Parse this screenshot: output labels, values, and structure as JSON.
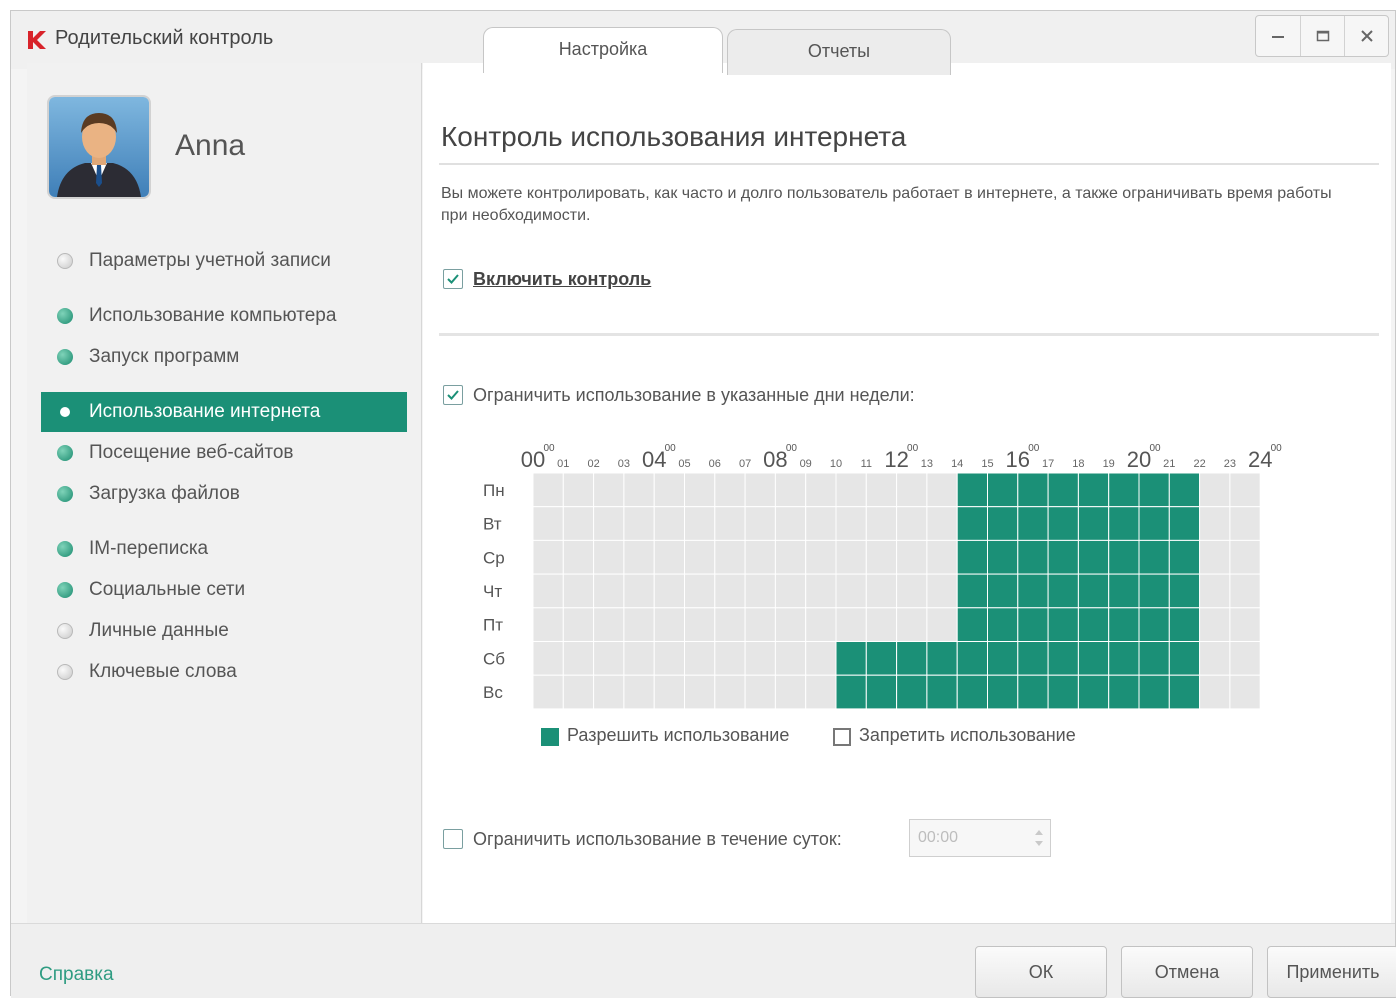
{
  "app": {
    "title": "Родительский контроль",
    "logo_icon": "kaspersky-k-icon",
    "accent_color": "#1b9077",
    "logo_color": "#d8232a"
  },
  "tabs": [
    {
      "label": "Настройка",
      "active": true
    },
    {
      "label": "Отчеты",
      "active": false
    }
  ],
  "window_controls": [
    "minimize-icon",
    "maximize-icon",
    "close-icon"
  ],
  "user": {
    "name": "Anna"
  },
  "sidebar": {
    "items": [
      {
        "label": "Параметры учетной записи",
        "status": "off"
      },
      {
        "label": "Использование компьютера",
        "status": "on"
      },
      {
        "label": "Запуск программ",
        "status": "on"
      },
      {
        "label": "Использование интернета",
        "status": "on",
        "selected": true
      },
      {
        "label": "Посещение веб-сайтов",
        "status": "on"
      },
      {
        "label": "Загрузка файлов",
        "status": "on"
      },
      {
        "label": "IM-переписка",
        "status": "on"
      },
      {
        "label": "Социальные сети",
        "status": "on"
      },
      {
        "label": "Личные данные",
        "status": "off"
      },
      {
        "label": "Ключевые слова",
        "status": "off"
      }
    ]
  },
  "main": {
    "title": "Контроль использования интернета",
    "description": "Вы можете контролировать, как часто и долго пользователь работает в интернете, а также ограничивать время работы при необходимости.",
    "enable_control": {
      "label": "Включить контроль",
      "checked": true
    },
    "limit_days": {
      "label": "Ограничить использование в указанные дни недели:",
      "checked": true
    },
    "schedule": {
      "days": [
        "Пн",
        "Вт",
        "Ср",
        "Чт",
        "Пт",
        "Сб",
        "Вс"
      ],
      "major_hours": [
        "00",
        "04",
        "08",
        "12",
        "16",
        "20",
        "24"
      ],
      "major_superscript": "00",
      "minor_hours": [
        "01",
        "02",
        "03",
        "05",
        "06",
        "07",
        "09",
        "10",
        "11",
        "13",
        "14",
        "15",
        "17",
        "18",
        "19",
        "21",
        "22",
        "23"
      ],
      "allowed": [
        {
          "day": "Пн",
          "from": 14,
          "to": 22
        },
        {
          "day": "Вт",
          "from": 14,
          "to": 22
        },
        {
          "day": "Ср",
          "from": 14,
          "to": 22
        },
        {
          "day": "Чт",
          "from": 14,
          "to": 22
        },
        {
          "day": "Пт",
          "from": 14,
          "to": 22
        },
        {
          "day": "Сб",
          "from": 10,
          "to": 22
        },
        {
          "day": "Вс",
          "from": 10,
          "to": 22
        }
      ],
      "allowed_color": "#1b9077",
      "denied_color": "#e6e6e6"
    },
    "legend": {
      "allow": "Разрешить использование",
      "deny": "Запретить использование"
    },
    "limit_daily": {
      "label": "Ограничить использование в течение суток:",
      "checked": false,
      "value": "00:00"
    }
  },
  "footer": {
    "help": "Справка",
    "ok": "ОК",
    "cancel": "Отмена",
    "apply": "Применить"
  }
}
